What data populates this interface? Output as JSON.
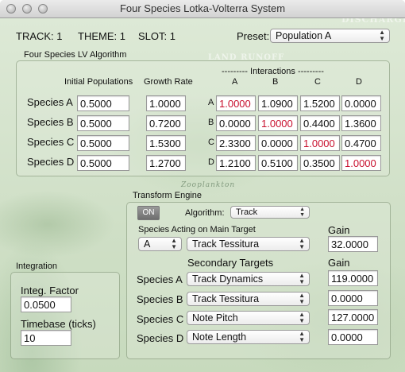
{
  "window": {
    "title": "Four Species Lotka-Volterra System"
  },
  "background_words": {
    "discharge": "DISCHARGE",
    "land_runoff": "LAND RUNOFF",
    "zooplankton": "Zooplankton"
  },
  "header": {
    "track_label": "TRACK:",
    "track_value": "1",
    "theme_label": "THEME:",
    "theme_value": "1",
    "slot_label": "SLOT:",
    "slot_value": "1",
    "preset_label": "Preset:",
    "preset_value": "Population A"
  },
  "algorithm_box": {
    "title": "Four Species LV Algorithm",
    "initial_populations_header": "Initial Populations",
    "growth_rate_header": "Growth Rate",
    "interactions_header": "--------- Interactions ---------",
    "interaction_cols": [
      "A",
      "B",
      "C",
      "D"
    ],
    "rows": [
      {
        "species": "Species A",
        "row_letter": "A",
        "initial": "0.5000",
        "growth": "1.0000",
        "interactions": [
          "1.0000",
          "1.0900",
          "1.5200",
          "0.0000"
        ]
      },
      {
        "species": "Species B",
        "row_letter": "B",
        "initial": "0.5000",
        "growth": "0.7200",
        "interactions": [
          "0.0000",
          "1.0000",
          "0.4400",
          "1.3600"
        ]
      },
      {
        "species": "Species C",
        "row_letter": "C",
        "initial": "0.5000",
        "growth": "1.5300",
        "interactions": [
          "2.3300",
          "0.0000",
          "1.0000",
          "0.4700"
        ]
      },
      {
        "species": "Species D",
        "row_letter": "D",
        "initial": "0.5000",
        "growth": "1.2700",
        "interactions": [
          "1.2100",
          "0.5100",
          "0.3500",
          "1.0000"
        ]
      }
    ]
  },
  "integration": {
    "title": "Integration",
    "integ_factor_label": "Integ. Factor",
    "integ_factor_value": "0.0500",
    "timebase_label": "Timebase (ticks)",
    "timebase_value": "10"
  },
  "transform": {
    "title": "Transform Engine",
    "on_label": "ON",
    "algorithm_label": "Algorithm:",
    "algorithm_value": "Track",
    "acting_label": "Species Acting on Main Target",
    "acting_species": "A",
    "main_target": "Track Tessitura",
    "gain_label": "Gain",
    "main_gain": "32.0000",
    "secondary_label": "Secondary Targets",
    "secondary_gain_label": "Gain",
    "secondary": [
      {
        "species": "Species A",
        "target": "Track Dynamics",
        "gain": "119.0000"
      },
      {
        "species": "Species B",
        "target": "Track Tessitura",
        "gain": "0.0000"
      },
      {
        "species": "Species C",
        "target": "Note Pitch",
        "gain": "127.0000"
      },
      {
        "species": "Species D",
        "target": "Note Length",
        "gain": "0.0000"
      }
    ]
  },
  "colors": {
    "diagonal_value_color": "#c8102e",
    "background": "#d8e6cf"
  }
}
